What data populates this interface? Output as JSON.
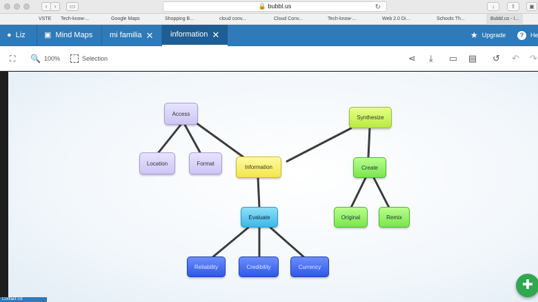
{
  "browser": {
    "url": "bubbl.us",
    "bookmarks": [
      "VSTE",
      "Tech-know-...",
      "Google Maps",
      "Shopping B...",
      "cloud conv...",
      "Cloud Conv...",
      "Tech-know-...",
      "Web 2.0 Di...",
      "Schools Th...",
      "Bubbl.us - I..."
    ]
  },
  "appbar": {
    "user": "Liz",
    "mind_maps": "Mind Maps",
    "tab_family": "mi familia",
    "tab_info": "information",
    "upgrade": "Upgrade",
    "help": "Hel"
  },
  "toolbar": {
    "zoom": "100%",
    "selection": "Selection"
  },
  "nodes": {
    "access": "Access",
    "location": "Location",
    "format": "Format",
    "information": "Information",
    "synthesize": "Synthesize",
    "create": "Create",
    "original": "Original",
    "remix": "Remix",
    "evaluate": "Evaluate",
    "reliability": "Reliability",
    "credibility": "Credibility",
    "currency": "Currency"
  },
  "bottom": {
    "tag": "Contact Us"
  },
  "colors": {
    "appbar": "#2f7ab8",
    "lavender": "#cdc6f4",
    "yellow": "#f2e64c",
    "green": "#79e64b",
    "cyan": "#3bb8e8",
    "blue": "#2f58e6"
  }
}
